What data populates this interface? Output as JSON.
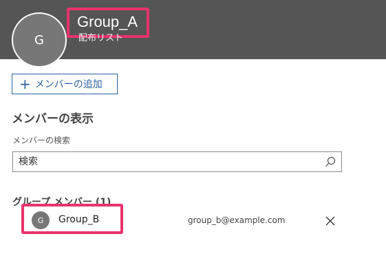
{
  "header": {
    "avatar_initial": "G",
    "title": "Group_A",
    "subtitle": "配布リスト"
  },
  "actions": {
    "add_member_label": "メンバーの追加"
  },
  "members_view": {
    "section_title": "メンバーの表示",
    "search_label": "メンバーの検索",
    "search_placeholder": "検索"
  },
  "group_members": {
    "heading": "グループ メンバー (1)",
    "items": [
      {
        "initial": "G",
        "name": "Group_B",
        "email": "group_b@example.com"
      }
    ]
  },
  "colors": {
    "header_bg": "#555555",
    "accent": "#2b5f9a",
    "highlight": "#e8336d"
  }
}
